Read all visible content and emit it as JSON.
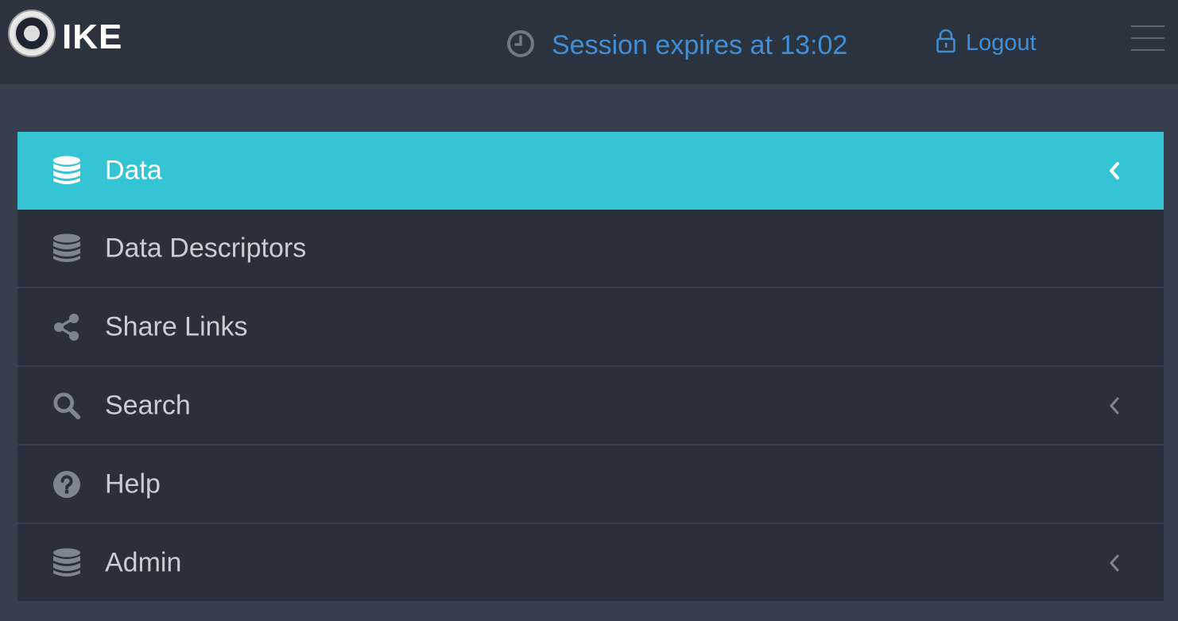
{
  "header": {
    "brand": "IKE",
    "session_text": "Session expires at 13:02",
    "logout_label": "Logout",
    "icons": {
      "logo": "seal-logo",
      "clock": "clock-icon",
      "lock": "lock-icon",
      "menu": "hamburger-menu-icon"
    }
  },
  "colors": {
    "accent": "#35c4d4",
    "link": "#3f8fd8",
    "topbar_bg": "#2b333e",
    "page_bg": "#353f4d",
    "item_bg": "#2a303b",
    "icon_gray": "#7d8592"
  },
  "menu": {
    "items": [
      {
        "label": "Data",
        "icon": "database-icon",
        "active": true,
        "has_submenu": true
      },
      {
        "label": "Data Descriptors",
        "icon": "database-icon",
        "active": false,
        "has_submenu": false
      },
      {
        "label": "Share Links",
        "icon": "share-icon",
        "active": false,
        "has_submenu": false
      },
      {
        "label": "Search",
        "icon": "search-icon",
        "active": false,
        "has_submenu": true
      },
      {
        "label": "Help",
        "icon": "question-circle-icon",
        "active": false,
        "has_submenu": false
      },
      {
        "label": "Admin",
        "icon": "database-icon",
        "active": false,
        "has_submenu": true
      }
    ]
  }
}
